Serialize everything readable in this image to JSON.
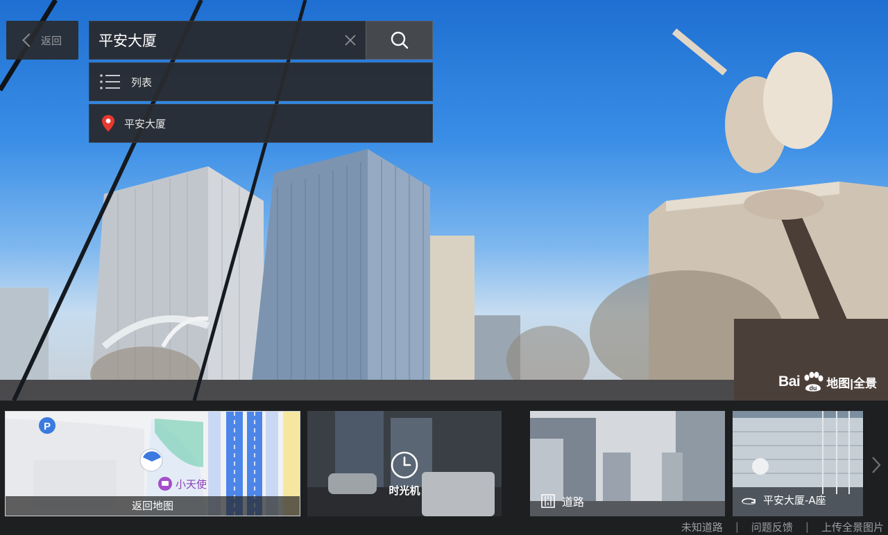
{
  "header": {
    "back_label": "返回",
    "search_value": "平安大厦"
  },
  "results": {
    "list_label": "列表",
    "place_label": "平安大厦"
  },
  "logo": {
    "bai": "Bai",
    "du": "du",
    "suffix": "地图|全景"
  },
  "thumbnails": {
    "map_caption": "返回地图",
    "map_poi_label": "小天使",
    "map_parking": "P",
    "time_label": "时光机",
    "road_label": "道路",
    "building_label": "平安大厦-A座"
  },
  "footer": {
    "links": [
      "未知道路",
      "问题反馈",
      "上传全景图片"
    ],
    "separator": "|"
  },
  "colors": {
    "panel_bg": "#28292e",
    "accent_red": "#e8382f",
    "poi_purple": "#a54ec9",
    "map_blue": "#3b7be0"
  }
}
